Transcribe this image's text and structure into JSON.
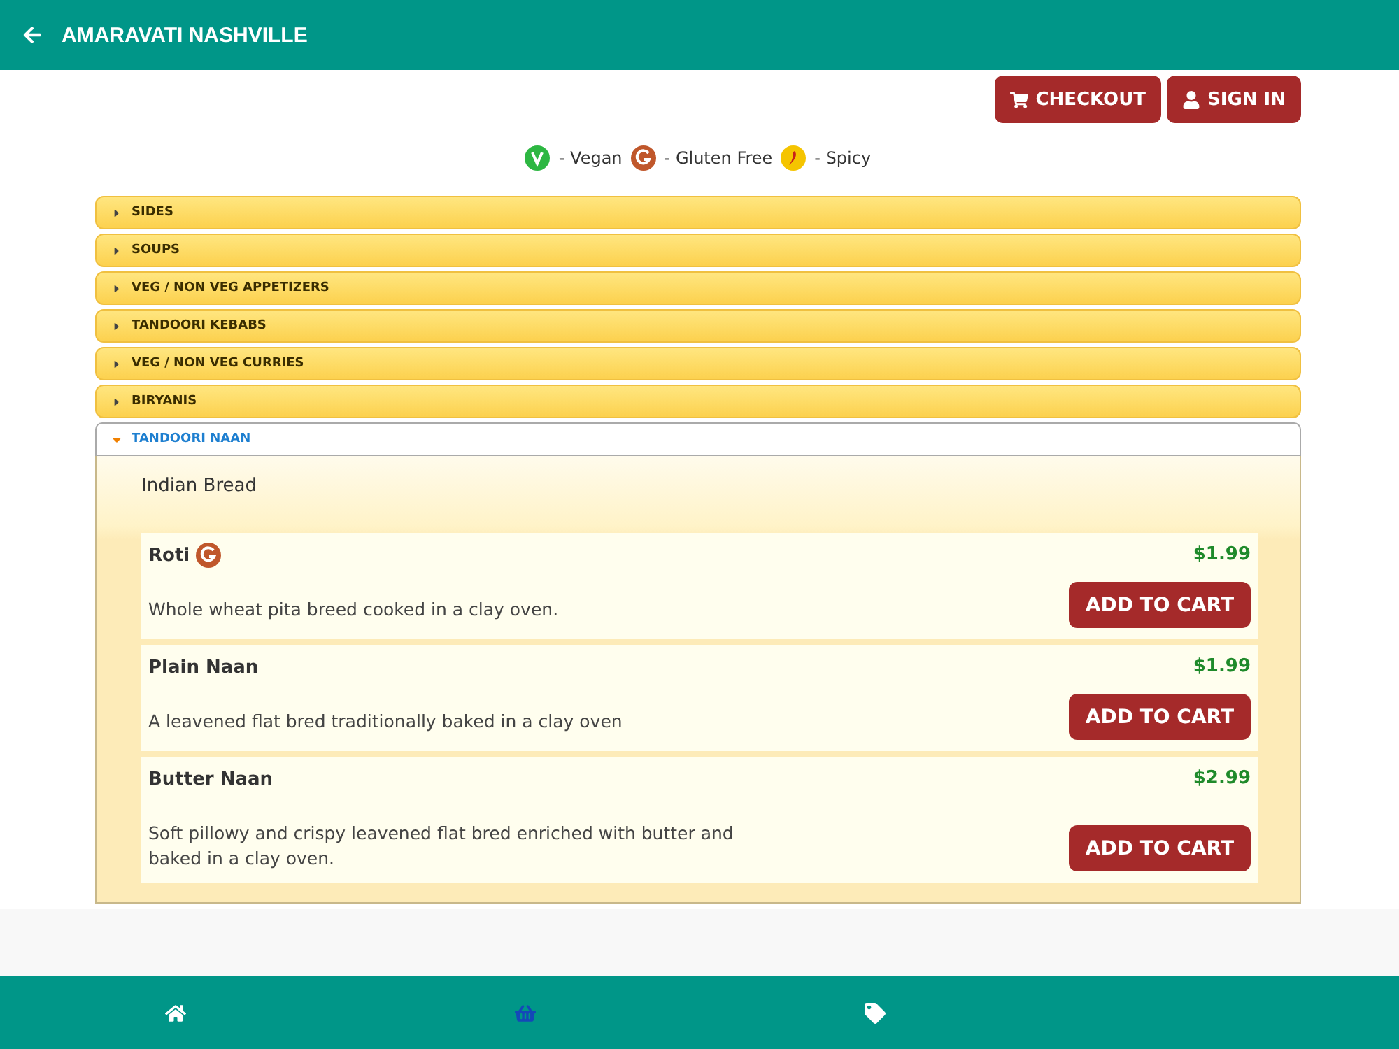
{
  "header": {
    "title": "AMARAVATI NASHVILLE"
  },
  "actions": [
    {
      "kind": "cart",
      "label": "CHECKOUT"
    },
    {
      "kind": "user",
      "label": "SIGN IN"
    }
  ],
  "legend": [
    {
      "kind": "vegan",
      "label": "- Vegan"
    },
    {
      "kind": "gluten",
      "label": "- Gluten Free"
    },
    {
      "kind": "spicy",
      "label": "- Spicy"
    }
  ],
  "categories": [
    {
      "title": "SIDES",
      "expanded": false
    },
    {
      "title": "SOUPS",
      "expanded": false
    },
    {
      "title": "VEG / NON VEG APPETIZERS",
      "expanded": false
    },
    {
      "title": "TANDOORI KEBABS",
      "expanded": false
    },
    {
      "title": "VEG / NON VEG CURRIES",
      "expanded": false
    },
    {
      "title": "BIRYANIS",
      "expanded": false
    },
    {
      "title": "TANDOORI NAAN",
      "expanded": true,
      "subtitle": "Indian Bread",
      "items": [
        {
          "name": "Roti",
          "gluten_free": true,
          "price": "$1.99",
          "description": "Whole wheat pita breed cooked in a clay oven.",
          "button": "ADD TO CART"
        },
        {
          "name": "Plain Naan",
          "price": "$1.99",
          "description": "A leavened flat bred traditionally baked in a clay oven",
          "button": "ADD TO CART"
        },
        {
          "name": "Butter Naan",
          "price": "$2.99",
          "description": "Soft pillowy and crispy leavened flat bred enriched with butter and baked in a clay oven.",
          "button": "ADD TO CART"
        }
      ]
    }
  ],
  "bottom_nav": [
    {
      "kind": "home",
      "selected": false
    },
    {
      "kind": "basket",
      "selected": true
    },
    {
      "kind": "tag",
      "selected": false
    }
  ]
}
